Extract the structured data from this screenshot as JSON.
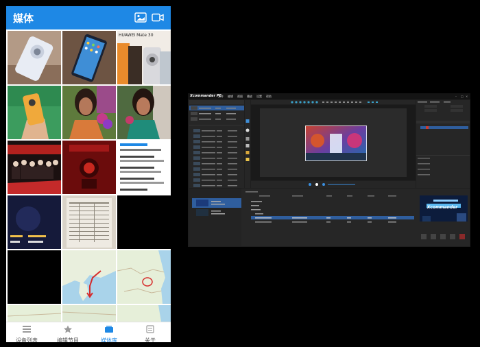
{
  "phone": {
    "title": "媒体",
    "header_icons": [
      "image-icon",
      "video-camera-icon"
    ],
    "accent": "#1e88e5",
    "tiles": [
      {
        "name": "white-phone-back-photo",
        "caption": ""
      },
      {
        "name": "phone-home-screen-photo",
        "caption": ""
      },
      {
        "name": "huawei-mate30-ad",
        "caption": "HUAWEI Mate 30"
      },
      {
        "name": "hand-holding-phone-photo",
        "caption": ""
      },
      {
        "name": "woman-portrait-photo-1",
        "caption": ""
      },
      {
        "name": "woman-portrait-photo-2",
        "caption": ""
      },
      {
        "name": "group-photo-red-banner",
        "caption": ""
      },
      {
        "name": "red-event-poster",
        "caption": ""
      },
      {
        "name": "chat-screenshot",
        "caption": ""
      },
      {
        "name": "dark-blue-poster",
        "caption": ""
      },
      {
        "name": "printed-document-photo",
        "caption": ""
      },
      {
        "name": "black-tile",
        "caption": ""
      },
      {
        "name": "black-tile-2",
        "caption": ""
      },
      {
        "name": "map-with-red-route",
        "caption": ""
      },
      {
        "name": "map-with-red-circle",
        "caption": ""
      }
    ],
    "tabs": [
      {
        "label": "设备列表",
        "icon": "device-list-icon",
        "active": false
      },
      {
        "label": "编辑节目",
        "icon": "edit-program-icon",
        "active": false
      },
      {
        "label": "媒体库",
        "icon": "media-library-icon",
        "active": true
      },
      {
        "label": "关于",
        "icon": "about-icon",
        "active": false
      }
    ]
  },
  "desktop": {
    "logo": "Xcommander",
    "logo_suffix": "PE",
    "menu": [
      "文件",
      "编辑",
      "视图",
      "播放",
      "设置",
      "帮助"
    ],
    "preview_overlay": "Xcommander"
  }
}
